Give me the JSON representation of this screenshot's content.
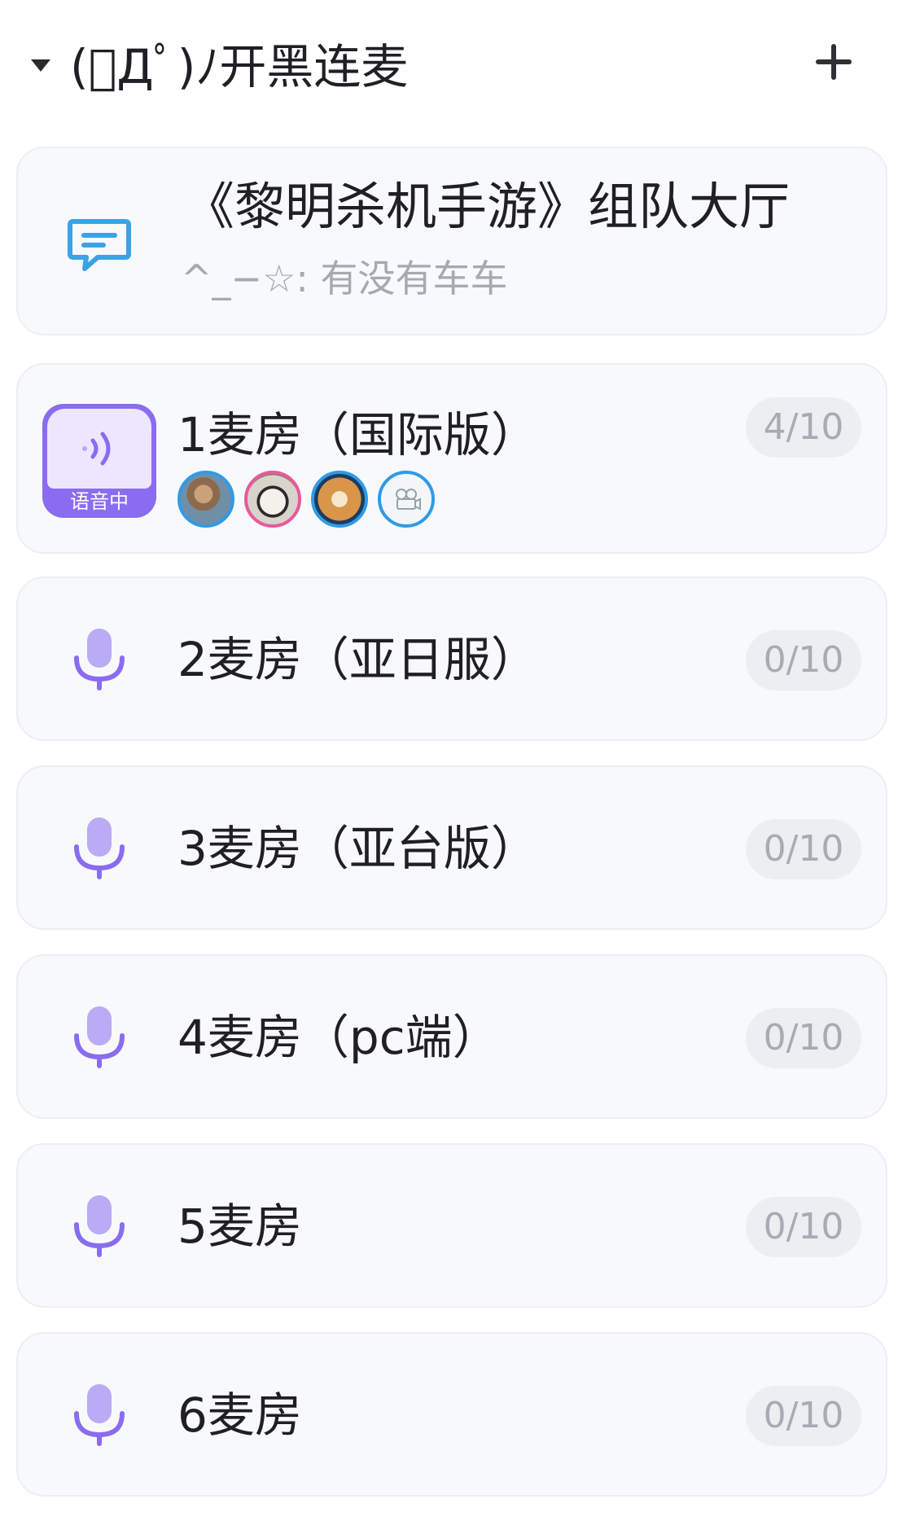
{
  "header": {
    "title": "(ﾟДﾟ)ﾉ开黑连麦"
  },
  "text_channel": {
    "name": "《黎明杀机手游》组队大厅",
    "last_message": "^_−☆: 有没有车车"
  },
  "voice_rooms": [
    {
      "name": "1麦房（国际版）",
      "count": "4/10",
      "status": "语音中",
      "members": [
        "avatar-1",
        "avatar-2",
        "avatar-3",
        "avatar-4"
      ]
    },
    {
      "name": "2麦房（亚日服）",
      "count": "0/10"
    },
    {
      "name": "3麦房（亚台版）",
      "count": "0/10"
    },
    {
      "name": "4麦房（pc端）",
      "count": "0/10"
    },
    {
      "name": "5麦房",
      "count": "0/10"
    },
    {
      "name": "6麦房",
      "count": "0/10"
    }
  ],
  "colors": {
    "accent": "#8a6cf0",
    "chat_icon": "#3aa3e8",
    "card_bg": "#f8f9fc",
    "badge_bg": "#eceef2"
  }
}
